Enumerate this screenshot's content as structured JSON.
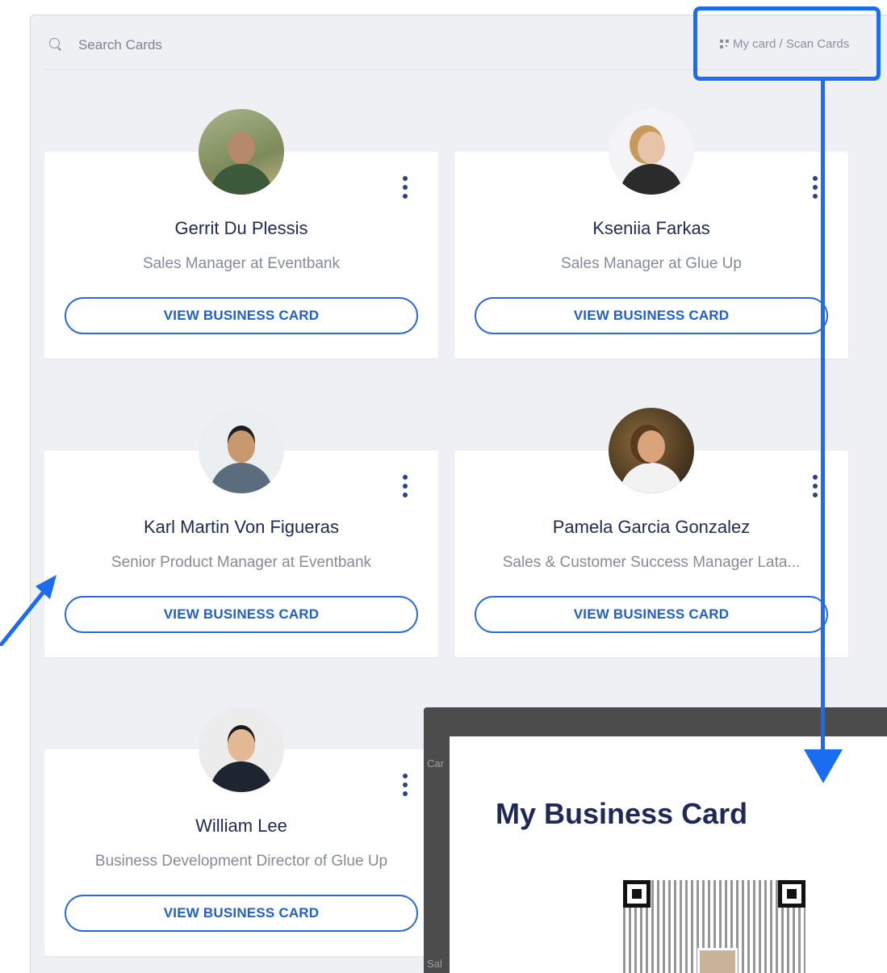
{
  "search": {
    "placeholder": "Search Cards"
  },
  "header": {
    "my_card_link": "My card / Scan Cards"
  },
  "cards": [
    {
      "name": "Gerrit Du Plessis",
      "title": "Sales Manager at Eventbank",
      "button": "VIEW BUSINESS CARD"
    },
    {
      "name": "Kseniia Farkas",
      "title": "Sales Manager at Glue Up",
      "button": "VIEW BUSINESS CARD"
    },
    {
      "name": "Karl Martin Von Figueras",
      "title": "Senior Product Manager at Eventbank",
      "button": "VIEW BUSINESS CARD"
    },
    {
      "name": "Pamela Garcia Gonzalez",
      "title": "Sales & Customer Success Manager Lata...",
      "button": "VIEW BUSINESS CARD"
    },
    {
      "name": "William Lee",
      "title": "Business Development Director of Glue Up",
      "button": "VIEW BUSINESS CARD"
    }
  ],
  "modal": {
    "title": "My Business Card",
    "peek_top": "Car",
    "peek_bottom": "Sal"
  },
  "colors": {
    "accent": "#1a6cf0",
    "button_border": "#2a6ad6",
    "name_text": "#1e2a55",
    "panel_bg": "#eef0f4"
  }
}
